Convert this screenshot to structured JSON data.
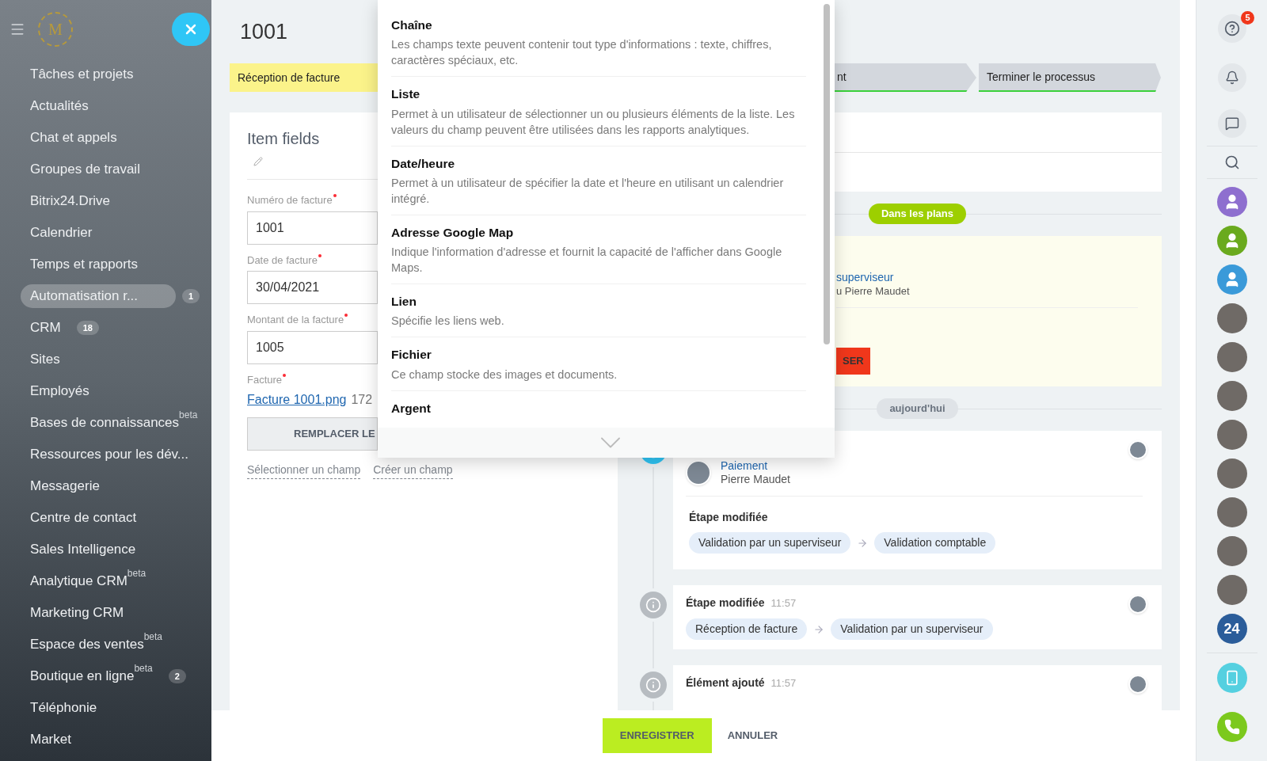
{
  "sidebar": {
    "logo_letter": "M",
    "items": [
      {
        "label": "Tâches et projets",
        "selected": false
      },
      {
        "label": "Actualités",
        "selected": false
      },
      {
        "label": "Chat et appels",
        "selected": false
      },
      {
        "label": "Groupes de travail",
        "selected": false
      },
      {
        "label": "Bitrix24.Drive",
        "selected": false
      },
      {
        "label": "Calendrier",
        "selected": false
      },
      {
        "label": "Temps et rapports",
        "selected": false
      },
      {
        "label": "Automatisation r...",
        "selected": true,
        "counter": "1"
      },
      {
        "label": "CRM",
        "selected": false,
        "counter": "18"
      },
      {
        "label": "Sites",
        "selected": false
      },
      {
        "label": "Employés",
        "selected": false
      },
      {
        "label": "Bases de connaissances",
        "selected": false,
        "beta": "beta"
      },
      {
        "label": "Ressources pour les dév...",
        "selected": false
      },
      {
        "label": "Messagerie",
        "selected": false
      },
      {
        "label": "Centre de contact",
        "selected": false
      },
      {
        "label": "Sales Intelligence",
        "selected": false
      },
      {
        "label": "Analytique CRM",
        "selected": false,
        "beta": "beta"
      },
      {
        "label": "Marketing CRM",
        "selected": false
      },
      {
        "label": "Espace des ventes",
        "selected": false,
        "beta": "beta"
      },
      {
        "label": "Boutique en ligne",
        "selected": false,
        "beta": "beta",
        "counter": "2"
      },
      {
        "label": "Téléphonie",
        "selected": false
      },
      {
        "label": "Market",
        "selected": false
      }
    ]
  },
  "record": {
    "title": "1001"
  },
  "stages": [
    {
      "label": "Réception de facture",
      "selected": true
    },
    {
      "label": "nt",
      "selected": false
    },
    {
      "label": "Terminer le processus",
      "selected": false
    }
  ],
  "fields_card": {
    "title": "Item fields",
    "fields": [
      {
        "label": "Numéro de facture",
        "required": true,
        "value": "1001"
      },
      {
        "label": "Date de facture",
        "required": true,
        "value": "30/04/2021"
      },
      {
        "label": "Montant de la facture",
        "required": true,
        "value": "1005"
      }
    ],
    "file": {
      "label": "Facture",
      "required": true,
      "link": "Facture 1001.png",
      "size": "172"
    },
    "replace_button": "REMPLACER LE",
    "links": [
      "Sélectionner un champ",
      "Créer un champ"
    ]
  },
  "field_type_menu": {
    "items": [
      {
        "title": "Chaîne",
        "description": "Les champs texte peuvent contenir tout type d'informations : texte, chiffres, caractères spéciaux, etc."
      },
      {
        "title": "Liste",
        "description": "Permet à un utilisateur de sélectionner un ou plusieurs éléments de la liste. Les valeurs du champ peuvent être utilisées dans les rapports analytiques."
      },
      {
        "title": "Date/heure",
        "description": "Permet à un utilisateur de spécifier la date et l'heure en utilisant un calendrier intégré."
      },
      {
        "title": "Adresse Google Map",
        "description": "Indique l'information d'adresse et fournit la capacité de l'afficher dans Google Maps."
      },
      {
        "title": "Lien",
        "description": "Spécifie les liens web."
      },
      {
        "title": "Fichier",
        "description": "Ce champ stocke des images et documents."
      },
      {
        "title": "Argent"
      }
    ]
  },
  "activity": {
    "plans_label": "Dans les plans",
    "task": {
      "link": "superviseur",
      "person": "u Pierre Maudet",
      "button": "SER"
    },
    "today_label": "aujourd'hui",
    "events": [
      {
        "kind": "task",
        "link": "Paiement",
        "person": "Pierre Maudet",
        "sub_title": "Étape modifiée",
        "from": "Validation par un superviseur",
        "to": "Validation comptable"
      },
      {
        "kind": "info",
        "title": "Étape modifiée",
        "time": "11:57",
        "from": "Réception de facture",
        "to": "Validation par un superviseur"
      },
      {
        "kind": "info",
        "title": "Élément ajouté",
        "time": "11:57"
      }
    ]
  },
  "footer": {
    "save": "ENREGISTRER",
    "cancel": "ANNULER"
  },
  "right_bar": {
    "help_badge": "5",
    "avatars": [
      {
        "kind": "silhouette",
        "color": "#8e6fcf"
      },
      {
        "kind": "silhouette",
        "color": "#6aaa1e"
      },
      {
        "kind": "silhouette",
        "color": "#3a9ad9"
      },
      {
        "kind": "photo"
      },
      {
        "kind": "photo"
      },
      {
        "kind": "photo"
      },
      {
        "kind": "photo"
      },
      {
        "kind": "photo"
      },
      {
        "kind": "photo"
      },
      {
        "kind": "photo"
      },
      {
        "kind": "photo"
      },
      {
        "kind": "logo",
        "text": "24"
      }
    ]
  }
}
